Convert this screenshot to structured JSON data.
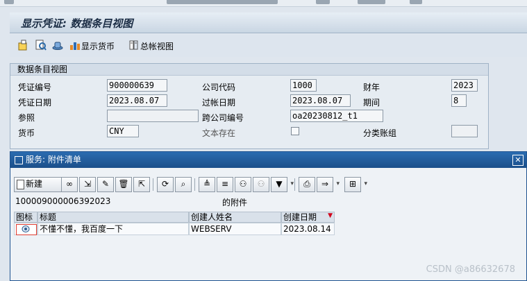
{
  "window": {
    "title": "显示凭证: 数据条目视图"
  },
  "app_toolbar": {
    "show_currency_label": "显示货币",
    "general_ledger_label": "总帐视图"
  },
  "header_group": {
    "title": "数据条目视图",
    "doc_number_label": "凭证编号",
    "doc_number_value": "900000639",
    "company_code_label": "公司代码",
    "company_code_value": "1000",
    "fiscal_year_label": "财年",
    "fiscal_year_value": "2023",
    "doc_date_label": "凭证日期",
    "doc_date_value": "2023.08.07",
    "posting_date_label": "过帐日期",
    "posting_date_value": "2023.08.07",
    "period_label": "期间",
    "period_value": "8",
    "reference_label": "参照",
    "reference_value": "",
    "cross_company_label": "跨公司编号",
    "cross_company_value": "oa20230812_t1",
    "currency_label": "货币",
    "currency_value": "CNY",
    "text_exists_label": "文本存在",
    "ledger_group_label": "分类账组",
    "ledger_group_value": ""
  },
  "dialog": {
    "title": "服务: 附件清单",
    "new_button_label": "新建",
    "object_key": "100009000006392023",
    "attachments_of_label": "的附件",
    "columns": {
      "icon": "图标",
      "title": "标题",
      "creator": "创建人姓名",
      "created_on": "创建日期"
    },
    "rows": [
      {
        "title": "不懂不懂，我百度一下",
        "creator": "WEBSERV",
        "created_on": "2023.08.14"
      }
    ]
  },
  "watermark": "CSDN @a86632678",
  "colors": {
    "dialog_title_bg": "#1f5390",
    "sort_marker": "#d0021b",
    "row_icon_border": "#e03c31"
  }
}
